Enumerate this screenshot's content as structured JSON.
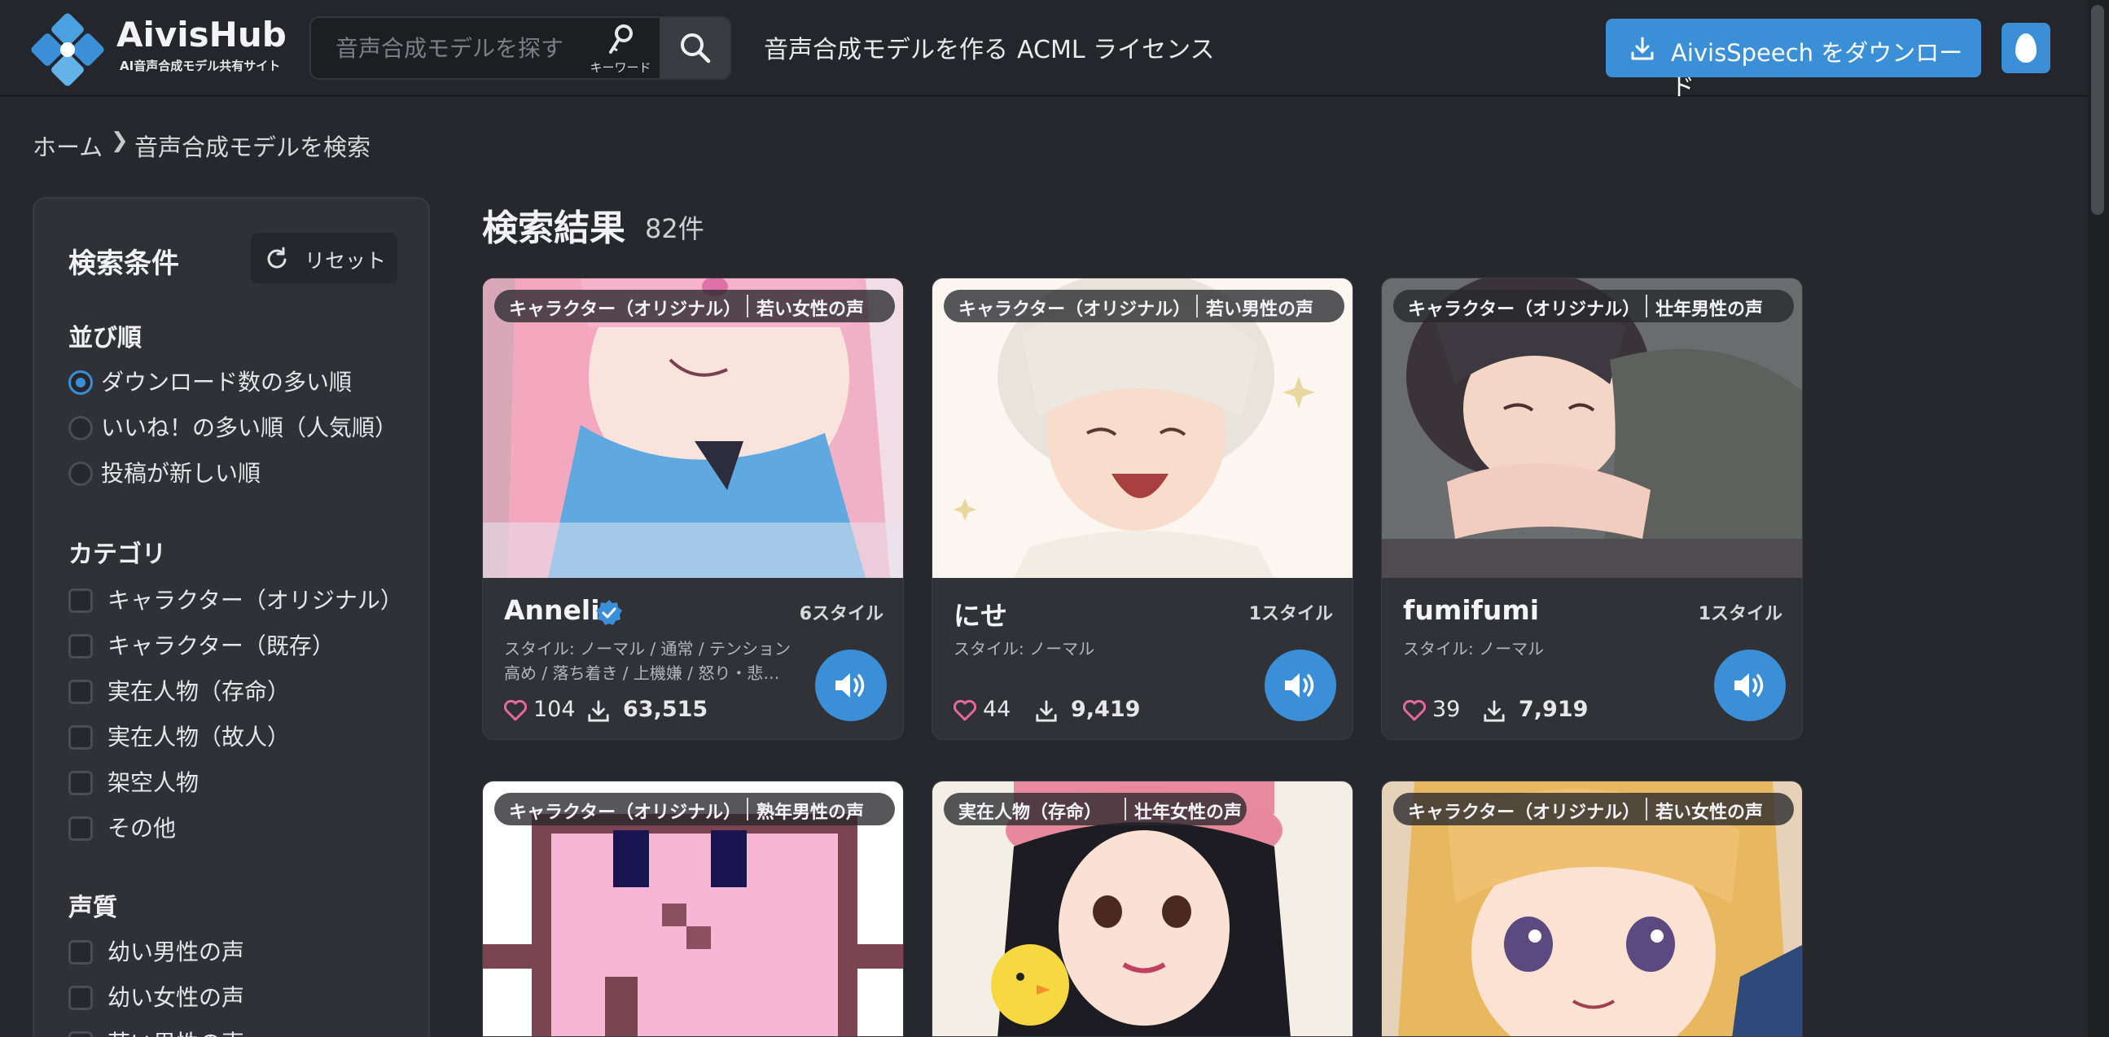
{
  "header": {
    "logo_title": "AivisHub",
    "logo_subtitle": "AI音声合成モデル共有サイト",
    "search_placeholder": "音声合成モデルを探す",
    "keyword_label": "キーワード",
    "nav": [
      "音声合成モデルを作る",
      "ACML ライセンス"
    ],
    "download_button": "AivisSpeech をダウンロード"
  },
  "breadcrumb": {
    "home": "ホーム",
    "separator": "❯",
    "current": "音声合成モデルを検索"
  },
  "sidebar": {
    "title": "検索条件",
    "reset_label": "リセット",
    "sort_heading": "並び順",
    "sort_options": [
      "ダウンロード数の多い順",
      "いいね！の多い順（人気順）",
      "投稿が新しい順"
    ],
    "sort_selected": 0,
    "category_heading": "カテゴリ",
    "category_options": [
      "キャラクター（オリジナル）",
      "キャラクター（既存）",
      "実在人物（存命）",
      "実在人物（故人）",
      "架空人物",
      "その他"
    ],
    "voice_heading": "声質",
    "voice_options": [
      "幼い男性の声",
      "幼い女性の声",
      "若い男性の声"
    ]
  },
  "results": {
    "title": "検索結果",
    "count": "82件",
    "cards": [
      {
        "category": "キャラクター（オリジナル）",
        "voice": "若い女性の声",
        "name": "Anneli",
        "verified": true,
        "styles": "6スタイル",
        "desc": "スタイル: ノーマル / 通常 / テンション高め / 落ち着き / 上機嫌 / 怒り・悲…",
        "likes": "104",
        "downloads": "63,515"
      },
      {
        "category": "キャラクター（オリジナル）",
        "voice": "若い男性の声",
        "name": "にせ",
        "verified": false,
        "styles": "1スタイル",
        "desc": "スタイル: ノーマル",
        "likes": "44",
        "downloads": "9,419"
      },
      {
        "category": "キャラクター（オリジナル）",
        "voice": "壮年男性の声",
        "name": "fumifumi",
        "verified": false,
        "styles": "1スタイル",
        "desc": "スタイル: ノーマル",
        "likes": "39",
        "downloads": "7,919"
      },
      {
        "category": "キャラクター（オリジナル）",
        "voice": "熟年男性の声"
      },
      {
        "category": "実在人物（存命）",
        "voice": "壮年女性の声"
      },
      {
        "category": "キャラクター（オリジナル）",
        "voice": "若い女性の声"
      }
    ]
  },
  "colors": {
    "accent": "#3a8fd6",
    "background": "#26282d",
    "panel": "#2f3137",
    "like": "#e86a9a"
  }
}
